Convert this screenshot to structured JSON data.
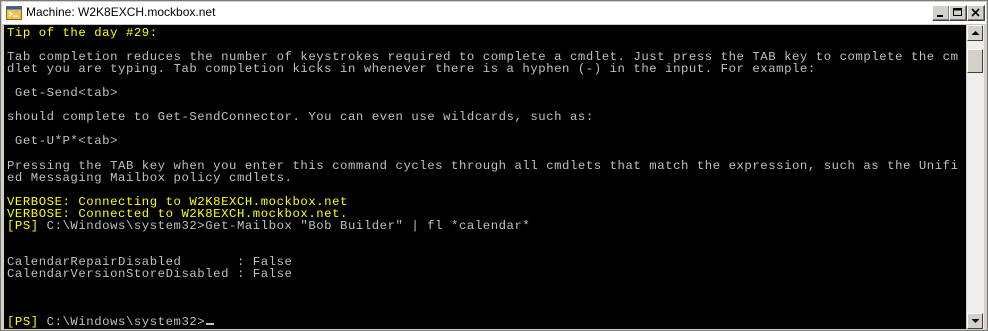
{
  "window": {
    "title": "Machine: W2K8EXCH.mockbox.net",
    "icon": "powershell-window-icon",
    "controls": [
      "minimize-icon",
      "maximize-icon",
      "close-icon"
    ]
  },
  "console": {
    "lines": [
      {
        "text": "Tip of the day #29:",
        "color": "yellow"
      },
      {
        "text": "",
        "color": "gray"
      },
      {
        "text": "Tab completion reduces the number of keystrokes required to complete a cmdlet. Just press the TAB key to complete the cm",
        "color": "gray"
      },
      {
        "text": "dlet you are typing. Tab completion kicks in whenever there is a hyphen (-) in the input. For example:",
        "color": "gray"
      },
      {
        "text": "",
        "color": "gray"
      },
      {
        "text": " Get-Send<tab>",
        "color": "gray"
      },
      {
        "text": "",
        "color": "gray"
      },
      {
        "text": "should complete to Get-SendConnector. You can even use wildcards, such as:",
        "color": "gray"
      },
      {
        "text": "",
        "color": "gray"
      },
      {
        "text": " Get-U*P*<tab>",
        "color": "gray"
      },
      {
        "text": "",
        "color": "gray"
      },
      {
        "text": "Pressing the TAB key when you enter this command cycles through all cmdlets that match the expression, such as the Unifi",
        "color": "gray"
      },
      {
        "text": "ed Messaging Mailbox policy cmdlets.",
        "color": "gray"
      },
      {
        "text": "",
        "color": "gray"
      },
      {
        "text": "VERBOSE: Connecting to W2K8EXCH.mockbox.net",
        "color": "yellow"
      },
      {
        "text": "VERBOSE: Connected to W2K8EXCH.mockbox.net.",
        "color": "yellow"
      },
      {
        "prompt": "[PS]",
        "text": " C:\\Windows\\system32>Get-Mailbox \"Bob Builder\" | fl *calendar*",
        "color": "gray"
      },
      {
        "text": "",
        "color": "gray"
      },
      {
        "text": "",
        "color": "gray"
      },
      {
        "text": "CalendarRepairDisabled       : False",
        "color": "gray"
      },
      {
        "text": "CalendarVersionStoreDisabled : False",
        "color": "gray"
      },
      {
        "text": "",
        "color": "gray"
      },
      {
        "text": "",
        "color": "gray"
      },
      {
        "text": "",
        "color": "gray"
      },
      {
        "prompt": "[PS]",
        "text": " C:\\Windows\\system32>",
        "color": "gray",
        "cursor": true
      }
    ]
  },
  "colors": {
    "console_bg": "#000000",
    "console_text": "#c0c0c0",
    "highlight": "#ffff00"
  },
  "scrollbar": {
    "up": "scroll-up-arrow-icon",
    "down": "scroll-down-arrow-icon"
  }
}
